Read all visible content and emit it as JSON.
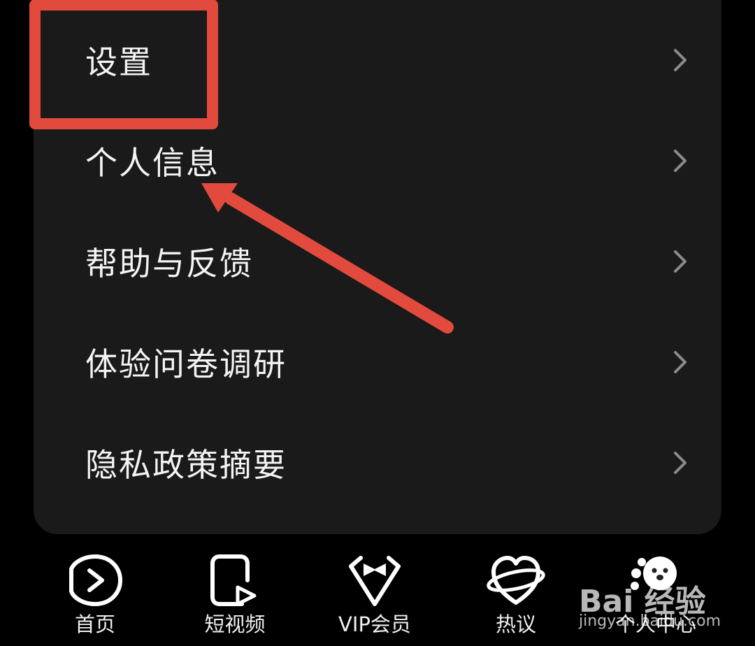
{
  "menu": {
    "items": [
      {
        "label": "设置",
        "icon": "chevron-right-icon"
      },
      {
        "label": "个人信息",
        "icon": "chevron-right-icon"
      },
      {
        "label": "帮助与反馈",
        "icon": "chevron-right-icon"
      },
      {
        "label": "体验问卷调研",
        "icon": "chevron-right-icon"
      },
      {
        "label": "隐私政策摘要",
        "icon": "chevron-right-icon"
      }
    ]
  },
  "annotation": {
    "highlight_color": "#e24a3d",
    "highlight_target": "设置"
  },
  "tabbar": {
    "tabs": [
      {
        "label": "首页",
        "icon": "play-circle-icon"
      },
      {
        "label": "短视频",
        "icon": "short-video-icon"
      },
      {
        "label": "VIP会员",
        "icon": "bowtie-vip-icon"
      },
      {
        "label": "热议",
        "icon": "heart-planet-icon"
      },
      {
        "label": "个人中心",
        "icon": "profile-icon"
      }
    ]
  },
  "watermark": {
    "title": "Bai 经验",
    "url": "jingyan.baidu.com"
  },
  "colors": {
    "background": "#000000",
    "card": "#1a1a1a",
    "text": "#f4f4f4",
    "chevron": "#8a8a8a"
  }
}
